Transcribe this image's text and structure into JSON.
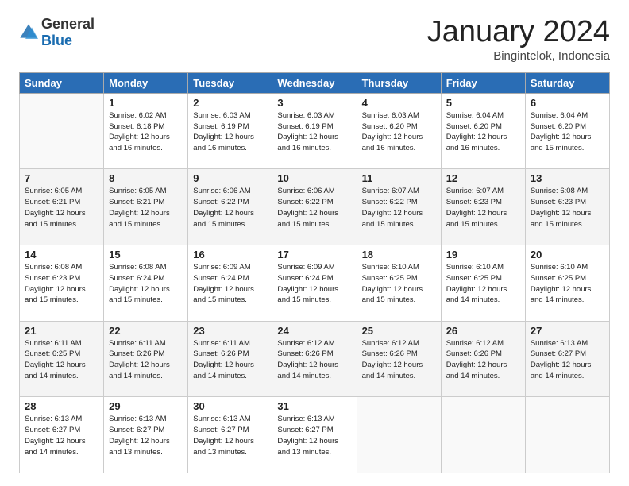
{
  "header": {
    "logo_general": "General",
    "logo_blue": "Blue",
    "month": "January 2024",
    "location": "Bingintelok, Indonesia"
  },
  "weekdays": [
    "Sunday",
    "Monday",
    "Tuesday",
    "Wednesday",
    "Thursday",
    "Friday",
    "Saturday"
  ],
  "weeks": [
    [
      {
        "day": "",
        "sunrise": "",
        "sunset": "",
        "daylight": ""
      },
      {
        "day": "1",
        "sunrise": "6:02 AM",
        "sunset": "6:18 PM",
        "daylight": "12 hours and 16 minutes."
      },
      {
        "day": "2",
        "sunrise": "6:03 AM",
        "sunset": "6:19 PM",
        "daylight": "12 hours and 16 minutes."
      },
      {
        "day": "3",
        "sunrise": "6:03 AM",
        "sunset": "6:19 PM",
        "daylight": "12 hours and 16 minutes."
      },
      {
        "day": "4",
        "sunrise": "6:03 AM",
        "sunset": "6:20 PM",
        "daylight": "12 hours and 16 minutes."
      },
      {
        "day": "5",
        "sunrise": "6:04 AM",
        "sunset": "6:20 PM",
        "daylight": "12 hours and 16 minutes."
      },
      {
        "day": "6",
        "sunrise": "6:04 AM",
        "sunset": "6:20 PM",
        "daylight": "12 hours and 15 minutes."
      }
    ],
    [
      {
        "day": "7",
        "sunrise": "6:05 AM",
        "sunset": "6:21 PM",
        "daylight": "12 hours and 15 minutes."
      },
      {
        "day": "8",
        "sunrise": "6:05 AM",
        "sunset": "6:21 PM",
        "daylight": "12 hours and 15 minutes."
      },
      {
        "day": "9",
        "sunrise": "6:06 AM",
        "sunset": "6:22 PM",
        "daylight": "12 hours and 15 minutes."
      },
      {
        "day": "10",
        "sunrise": "6:06 AM",
        "sunset": "6:22 PM",
        "daylight": "12 hours and 15 minutes."
      },
      {
        "day": "11",
        "sunrise": "6:07 AM",
        "sunset": "6:22 PM",
        "daylight": "12 hours and 15 minutes."
      },
      {
        "day": "12",
        "sunrise": "6:07 AM",
        "sunset": "6:23 PM",
        "daylight": "12 hours and 15 minutes."
      },
      {
        "day": "13",
        "sunrise": "6:08 AM",
        "sunset": "6:23 PM",
        "daylight": "12 hours and 15 minutes."
      }
    ],
    [
      {
        "day": "14",
        "sunrise": "6:08 AM",
        "sunset": "6:23 PM",
        "daylight": "12 hours and 15 minutes."
      },
      {
        "day": "15",
        "sunrise": "6:08 AM",
        "sunset": "6:24 PM",
        "daylight": "12 hours and 15 minutes."
      },
      {
        "day": "16",
        "sunrise": "6:09 AM",
        "sunset": "6:24 PM",
        "daylight": "12 hours and 15 minutes."
      },
      {
        "day": "17",
        "sunrise": "6:09 AM",
        "sunset": "6:24 PM",
        "daylight": "12 hours and 15 minutes."
      },
      {
        "day": "18",
        "sunrise": "6:10 AM",
        "sunset": "6:25 PM",
        "daylight": "12 hours and 15 minutes."
      },
      {
        "day": "19",
        "sunrise": "6:10 AM",
        "sunset": "6:25 PM",
        "daylight": "12 hours and 14 minutes."
      },
      {
        "day": "20",
        "sunrise": "6:10 AM",
        "sunset": "6:25 PM",
        "daylight": "12 hours and 14 minutes."
      }
    ],
    [
      {
        "day": "21",
        "sunrise": "6:11 AM",
        "sunset": "6:25 PM",
        "daylight": "12 hours and 14 minutes."
      },
      {
        "day": "22",
        "sunrise": "6:11 AM",
        "sunset": "6:26 PM",
        "daylight": "12 hours and 14 minutes."
      },
      {
        "day": "23",
        "sunrise": "6:11 AM",
        "sunset": "6:26 PM",
        "daylight": "12 hours and 14 minutes."
      },
      {
        "day": "24",
        "sunrise": "6:12 AM",
        "sunset": "6:26 PM",
        "daylight": "12 hours and 14 minutes."
      },
      {
        "day": "25",
        "sunrise": "6:12 AM",
        "sunset": "6:26 PM",
        "daylight": "12 hours and 14 minutes."
      },
      {
        "day": "26",
        "sunrise": "6:12 AM",
        "sunset": "6:26 PM",
        "daylight": "12 hours and 14 minutes."
      },
      {
        "day": "27",
        "sunrise": "6:13 AM",
        "sunset": "6:27 PM",
        "daylight": "12 hours and 14 minutes."
      }
    ],
    [
      {
        "day": "28",
        "sunrise": "6:13 AM",
        "sunset": "6:27 PM",
        "daylight": "12 hours and 14 minutes."
      },
      {
        "day": "29",
        "sunrise": "6:13 AM",
        "sunset": "6:27 PM",
        "daylight": "12 hours and 13 minutes."
      },
      {
        "day": "30",
        "sunrise": "6:13 AM",
        "sunset": "6:27 PM",
        "daylight": "12 hours and 13 minutes."
      },
      {
        "day": "31",
        "sunrise": "6:13 AM",
        "sunset": "6:27 PM",
        "daylight": "12 hours and 13 minutes."
      },
      {
        "day": "",
        "sunrise": "",
        "sunset": "",
        "daylight": ""
      },
      {
        "day": "",
        "sunrise": "",
        "sunset": "",
        "daylight": ""
      },
      {
        "day": "",
        "sunrise": "",
        "sunset": "",
        "daylight": ""
      }
    ]
  ],
  "labels": {
    "sunrise_prefix": "Sunrise: ",
    "sunset_prefix": "Sunset: ",
    "daylight_prefix": "Daylight: "
  }
}
